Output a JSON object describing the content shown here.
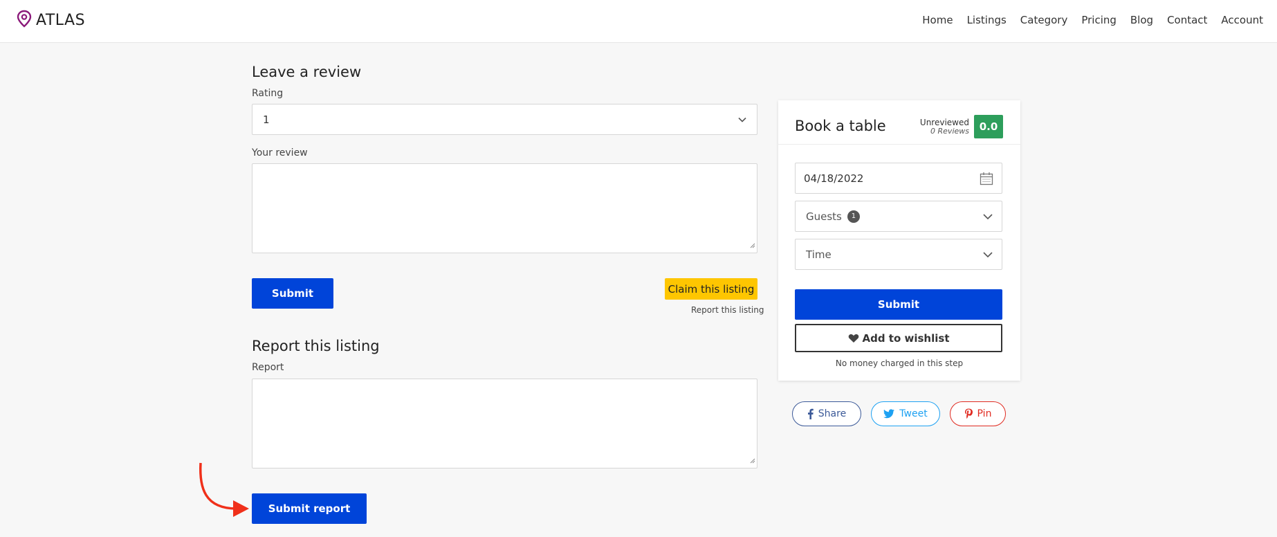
{
  "brand": {
    "name": "ATLAS",
    "accent": "#8b1a7a"
  },
  "nav": [
    "Home",
    "Listings",
    "Category",
    "Pricing",
    "Blog",
    "Contact",
    "Account"
  ],
  "review": {
    "heading": "Leave a review",
    "rating_label": "Rating",
    "rating_value": "1",
    "review_label": "Your review",
    "submit_label": "Submit",
    "claim_label": "Claim this listing",
    "report_link": "Report this listing"
  },
  "report": {
    "heading": "Report this listing",
    "label": "Report",
    "submit_label": "Submit report"
  },
  "booking": {
    "title": "Book a table",
    "status": "Unreviewed",
    "reviews_count": "0 Reviews",
    "score": "0.0",
    "date": "04/18/2022",
    "guests_label": "Guests",
    "guests_count": "1",
    "time_label": "Time",
    "submit_label": "Submit",
    "wishlist_label": "Add to wishlist",
    "note": "No money charged in this step"
  },
  "share": {
    "facebook": "Share",
    "twitter": "Tweet",
    "pinterest": "Pin"
  },
  "colors": {
    "primary": "#0044d9",
    "claim": "#fec601",
    "score": "#2d9e5b",
    "facebook": "#3b5998",
    "twitter": "#1da1f2",
    "pinterest": "#e02a20",
    "annotation_arrow": "#f0301a"
  }
}
